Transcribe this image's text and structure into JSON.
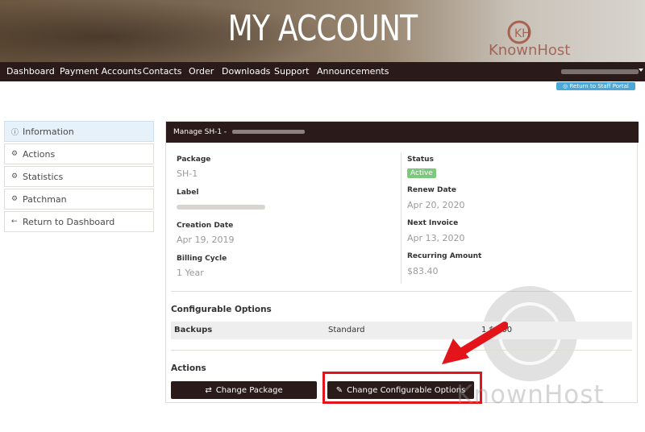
{
  "hero": {
    "title": "MY ACCOUNT",
    "logo_text": "KnownHost"
  },
  "nav": {
    "items": [
      "Dashboard",
      "Payment Accounts",
      "Contacts",
      "Order",
      "Downloads",
      "Support",
      "Announcements"
    ]
  },
  "staff_portal": "◎ Return to Staff Portal",
  "sidebar": {
    "items": [
      {
        "label": "Information",
        "icon": "info-icon"
      },
      {
        "label": "Actions",
        "icon": "gear-icon"
      },
      {
        "label": "Statistics",
        "icon": "gear-icon"
      },
      {
        "label": "Patchman",
        "icon": "gear-icon"
      },
      {
        "label": "Return to Dashboard",
        "icon": "arrow-left-icon"
      }
    ]
  },
  "panel": {
    "header": "Manage SH-1 -",
    "package_label": "Package",
    "package_value": "SH-1",
    "label_label": "Label",
    "creation_label": "Creation Date",
    "creation_value": "Apr 19, 2019",
    "billing_label": "Billing Cycle",
    "billing_value": "1 Year",
    "status_label": "Status",
    "status_value": "Active",
    "renew_label": "Renew Date",
    "renew_value": "Apr 20, 2020",
    "invoice_label": "Next Invoice",
    "invoice_value": "Apr 13, 2020",
    "recurring_label": "Recurring Amount",
    "recurring_value": "$83.40"
  },
  "config": {
    "title": "Configurable Options",
    "rows": [
      {
        "name": "Backups",
        "option": "Standard",
        "price": "1 $0.00"
      }
    ]
  },
  "actions": {
    "title": "Actions",
    "change_package": "Change Package",
    "change_config": "Change Configurable Options"
  },
  "colors": {
    "nav_bg": "#2b1a1a",
    "accent_red": "#e4141b",
    "status_green": "#7cc97c",
    "staff_blue": "#4ca8d8"
  },
  "watermark": {
    "text": "KnownHost"
  }
}
